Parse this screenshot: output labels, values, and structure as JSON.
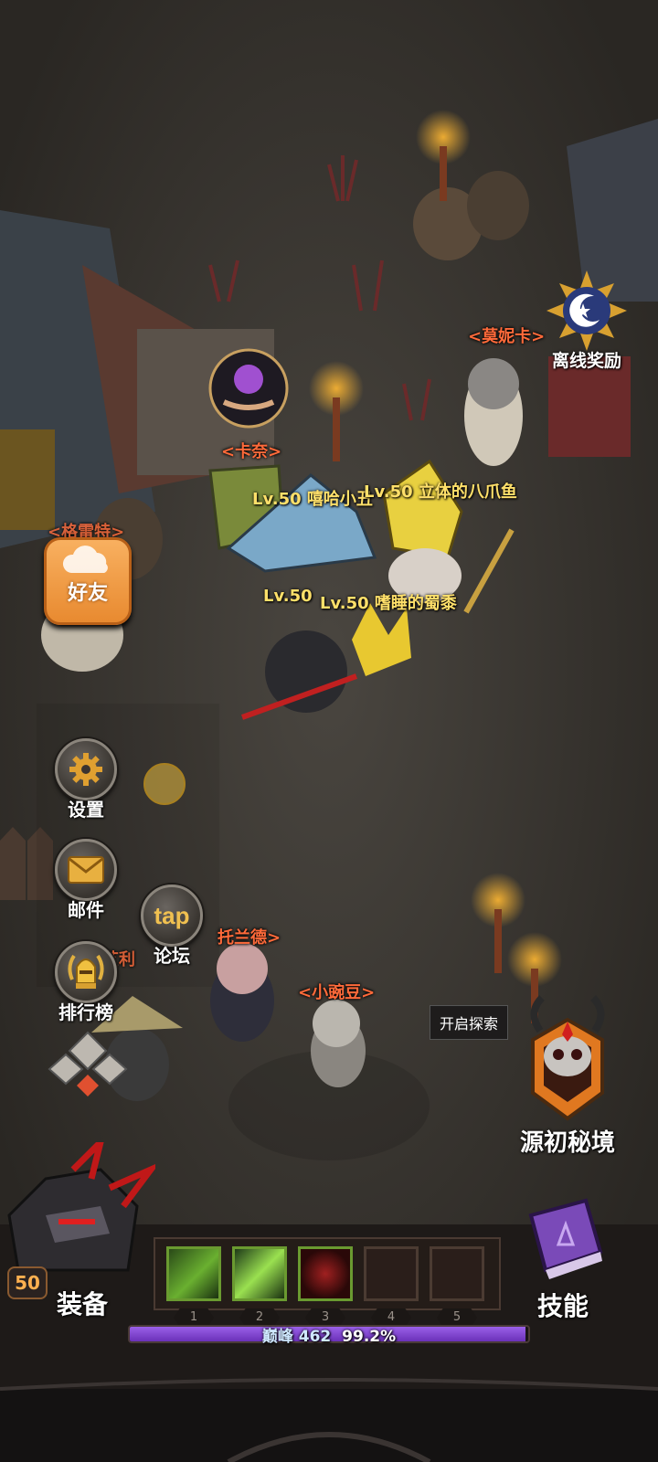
{
  "offline_reward": {
    "label": "离线奖励"
  },
  "friends": {
    "label": "好友"
  },
  "side_menu": {
    "settings": "设置",
    "mail": "邮件",
    "forum_logo": "tap",
    "forum": "论坛",
    "ranking": "排行榜"
  },
  "npcs": {
    "monica": "<莫妮卡>",
    "kana": "<卡奈>",
    "gerui": "<格雷特>",
    "toland": "托兰德>",
    "xiaowandou": "<小豌豆>",
    "aili": "艾利"
  },
  "players": {
    "p1": "Lv.50  嘻哈小丑",
    "p2": "Lv.50 立体的八爪鱼",
    "p3": "Lv.50",
    "p4": "Lv.50 嗜睡的蜀黍"
  },
  "explore": {
    "tooltip": "开启探索",
    "label": "源初秘境"
  },
  "bottom": {
    "level": "50",
    "equip_label": "装备",
    "skill_label": "技能",
    "slots": [
      "1",
      "2",
      "3",
      "4",
      "5"
    ],
    "rank_label": "巅峰",
    "rank_value": "462",
    "progress_text": "99.2%",
    "progress_fraction": 0.992
  },
  "colors": {
    "npc_name": "#ff6a3a",
    "player_name": "#ffe06a",
    "progress": "#7b3fd0"
  }
}
